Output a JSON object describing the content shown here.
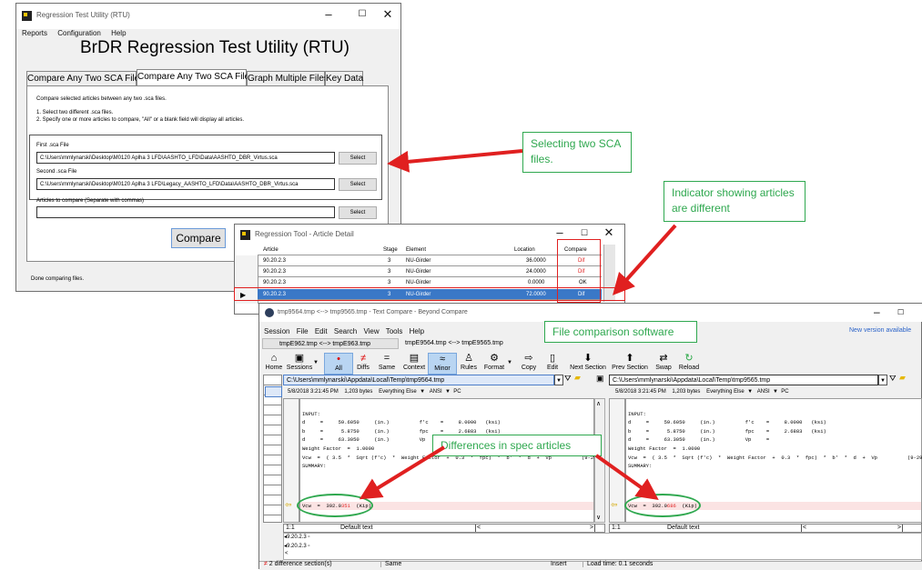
{
  "rtu": {
    "window_title": "Regression Test Utility (RTU)",
    "menu": [
      "Reports",
      "Configuration",
      "Help"
    ],
    "app_heading": "BrDR Regression Test Utility (RTU)",
    "tabs": [
      "Compare Any Two SCA Files",
      "Compare Any Two SCA Files",
      "Graph Multiple Files",
      "Key Data"
    ],
    "instructions": [
      "Compare selected articles between any two .sca files.",
      "1.  Select two different .sca files.",
      "2.  Specify one or more articles to compare,  \"All\" or a blank field will display all articles."
    ],
    "first_label": "First .sca File",
    "first_path": "C:\\Users\\mmlynarski\\Desktop\\M0120 Aplha 3 LFD\\AASHTO_LFD\\Data\\AASHTO_DBR_Virtus.sca",
    "second_label": "Second .sca File",
    "second_path": "C:\\Users\\mmlynarski\\Desktop\\M0120 Aplha 3 LFD\\Legacy_AASHTO_LFD\\Data\\AASHTO_DBR_Virtus.sca",
    "articles_label": "Articles to compare (Separate with commas)",
    "articles_value": "",
    "select_label": "Select",
    "compare_label": "Compare",
    "status": "Done comparing files."
  },
  "article_detail": {
    "window_title": "Regression Tool - Article Detail",
    "columns": [
      "Article",
      "Stage",
      "Element",
      "Location",
      "Compare"
    ],
    "rows": [
      {
        "article": "90.20.2.3",
        "stage": "3",
        "element": "NU-Girder",
        "location": "36.0000",
        "compare": "Dif"
      },
      {
        "article": "90.20.2.3",
        "stage": "3",
        "element": "NU-Girder",
        "location": "24.0000",
        "compare": "Dif"
      },
      {
        "article": "90.20.2.3",
        "stage": "3",
        "element": "NU-Girder",
        "location": "0.0000",
        "compare": "OK"
      },
      {
        "article": "90.20.2.3",
        "stage": "3",
        "element": "NU-Girder",
        "location": "72.0000",
        "compare": "Dif"
      }
    ]
  },
  "beyond_compare": {
    "window_title": "tmp9564.tmp <--> tmp9565.tmp - Text Compare - Beyond Compare",
    "menu": [
      "Session",
      "File",
      "Edit",
      "Search",
      "View",
      "Tools",
      "Help"
    ],
    "new_version": "New version available",
    "tabs": [
      "tmpE962.tmp <--> tmpE963.tmp",
      "tmpE9564.tmp <--> tmpE9565.tmp"
    ],
    "toolbar": [
      {
        "label": "Home",
        "icon": "⌂"
      },
      {
        "label": "Sessions",
        "icon": "▣"
      },
      {
        "label": "All",
        "icon": "•"
      },
      {
        "label": "Diffs",
        "icon": "≠"
      },
      {
        "label": "Same",
        "icon": "="
      },
      {
        "label": "Context",
        "icon": "▤"
      },
      {
        "label": "Minor",
        "icon": "≈"
      },
      {
        "label": "Rules",
        "icon": "♙"
      },
      {
        "label": "Format",
        "icon": "⚙"
      },
      {
        "label": "Copy",
        "icon": "⇨"
      },
      {
        "label": "Edit",
        "icon": "▯"
      },
      {
        "label": "Next Section",
        "icon": "⬇"
      },
      {
        "label": "Prev Section",
        "icon": "⬆"
      },
      {
        "label": "Swap",
        "icon": "⇄"
      },
      {
        "label": "Reload",
        "icon": "↻"
      }
    ],
    "left_path": "C:\\Users\\mmlynarski\\Appdata\\Local\\Temp\\tmp9564.tmp",
    "right_path": "C:\\Users\\mmlynarski\\Appdata\\Local\\Temp\\tmp9565.tmp",
    "left_info": "5/8/2018 3:21:45 PM    1,203 bytes    Everything Else  ▼   ANSI  ▼  PC",
    "right_info": "5/8/2018 3:21:45 PM    1,203 bytes    Everything Else  ▼   ANSI  ▼  PC",
    "text_lines": [
      "INPUT:",
      "",
      "d     =     59.6050     (in.)          f'c    =     8.0000   (ksi)",
      "b     =      5.8750     (in.)          fpc    =     2.6883   (ksi)",
      "d     =     63.3050     (in.)          Vp     =",
      "Weight Factor  =  1.0000",
      "",
      "",
      "Vcw  =  ( 3.5  *  Sqrt (f'c)  *  Weight Factor  +  0.3  *  fpc)  *  b'  *  d  +  Vp          (9-29)",
      "",
      "",
      "SUMMARY:"
    ],
    "left_diff_prefix": "Vcw  =  392.0",
    "left_diff_highlight": "351",
    "left_diff_suffix": "  (Kip)",
    "right_diff_prefix": "Vcw  =  392.0",
    "right_diff_highlight": "686",
    "right_diff_suffix": "  (Kip)",
    "position": "1:1",
    "encoding_hint": "Default text",
    "tree_items": [
      "9.20.2.3",
      "9.20.2.3"
    ],
    "status_diffs": "2 difference section(s)",
    "status_same": "Same",
    "status_insert": "Insert",
    "status_load": "Load time: 0.1 seconds"
  },
  "callouts": {
    "select_files": "Selecting two SCA files.",
    "indicator": "Indicator showing articles are different",
    "software": "File comparison software",
    "differences": "Differences in spec articles"
  },
  "colors": {
    "callout": "#2fa84f",
    "arrow": "#e02020",
    "highlight_row": "#3a78c7",
    "dif_text": "#e02020"
  }
}
